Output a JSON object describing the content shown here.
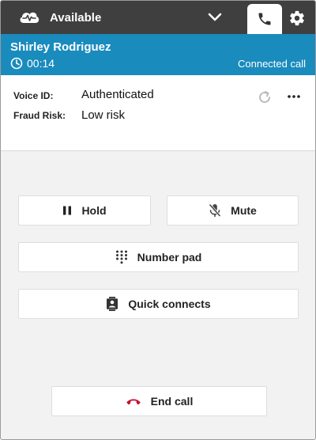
{
  "header": {
    "agent_status": "Available",
    "icons": [
      "status-cloud-icon",
      "chevron-down-icon",
      "phone-icon",
      "gear-icon"
    ]
  },
  "contact": {
    "name": "Shirley Rodriguez",
    "timer": "00:14",
    "state": "Connected call"
  },
  "details": {
    "voice_id_label": "Voice ID:",
    "voice_id_value": "Authenticated",
    "fraud_label": "Fraud Risk:",
    "fraud_value": "Low risk"
  },
  "controls": {
    "hold": "Hold",
    "mute": "Mute",
    "number_pad": "Number pad",
    "quick_connects": "Quick connects",
    "end_call": "End call"
  },
  "colors": {
    "top_bar": "#3f3f3f",
    "banner": "#1a8bbd",
    "panel_bg": "#f2f2f2",
    "end_call_icon": "#c8102e"
  }
}
